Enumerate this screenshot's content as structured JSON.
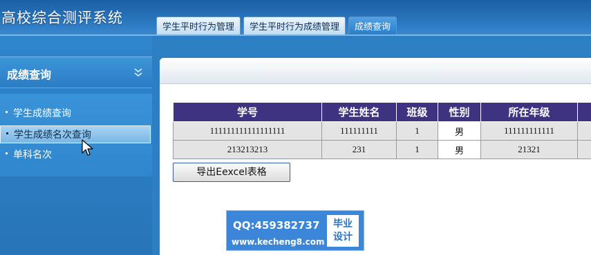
{
  "app": {
    "title": "高校综合测评系统"
  },
  "tabs": [
    {
      "label": "学生平时行为管理"
    },
    {
      "label": "学生平时行为成绩管理"
    },
    {
      "label": "成绩查询"
    }
  ],
  "sidebar": {
    "title": "成绩查询",
    "items": [
      {
        "label": "学生成绩查询"
      },
      {
        "label": "学生成绩名次查询"
      },
      {
        "label": "单科名次"
      }
    ]
  },
  "table": {
    "headers": [
      "学号",
      "学生姓名",
      "班级",
      "性别",
      "所在年级",
      ""
    ],
    "rows": [
      [
        "111111111111111111",
        "111111111",
        "1",
        "男",
        "111111111111",
        ""
      ],
      [
        "213213213",
        "231",
        "1",
        "男",
        "21321",
        ""
      ]
    ]
  },
  "export_button": {
    "label": "导出Eexcel表格"
  },
  "watermark": {
    "qq": "QQ:459382737",
    "url": "www.kecheng8.com",
    "badge_line1": "毕业",
    "badge_line2": "设计"
  },
  "colors": {
    "table_header": "#3d3380",
    "header_bg": "#2a77bf",
    "sidebar_bg": "#2f86cc",
    "selected_item": "#a9d3f2"
  }
}
